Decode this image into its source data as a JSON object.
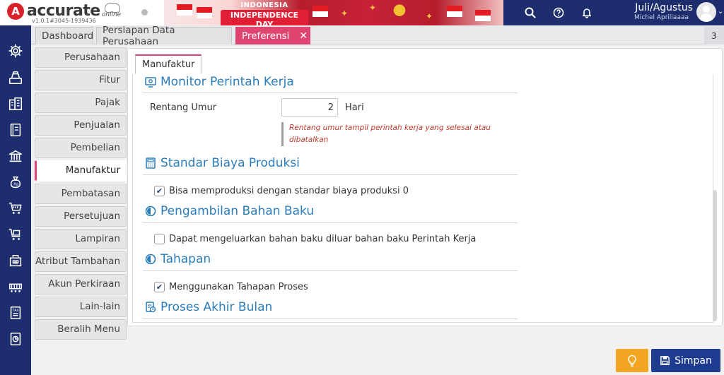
{
  "app": {
    "brand": "accurate",
    "brand_suffix": "online",
    "version": "v1.0.1#3045-1939436",
    "banner_line1": "INDONESIA",
    "banner_line2": "INDEPENDENCE DAY"
  },
  "user": {
    "period": "Juli/Agustus",
    "name": "Michel Apriliaaaa"
  },
  "header_icons": [
    "search-icon",
    "help-icon",
    "bell-icon"
  ],
  "rail_icons": [
    "gear-icon",
    "cash-register-icon",
    "building-icon",
    "ledger-book-icon",
    "bank-icon",
    "money-bag-icon",
    "shopping-cart-icon",
    "cart-box-icon",
    "warehouse-icon",
    "production-line-icon",
    "tax-icon",
    "report-chart-icon"
  ],
  "tabs": [
    {
      "label": "Dashboard",
      "active": false
    },
    {
      "label": "Persiapan Data Perusahaan",
      "active": false
    },
    {
      "label": "Preferensi",
      "active": true
    }
  ],
  "tab_count": "3",
  "sections_menu": [
    {
      "label": "Perusahaan",
      "active": false
    },
    {
      "label": "Fitur",
      "active": false
    },
    {
      "label": "Pajak",
      "active": false
    },
    {
      "label": "Penjualan",
      "active": false
    },
    {
      "label": "Pembelian",
      "active": false
    },
    {
      "label": "Manufaktur",
      "active": true
    },
    {
      "label": "Pembatasan",
      "active": false
    },
    {
      "label": "Persetujuan",
      "active": false
    },
    {
      "label": "Lampiran",
      "active": false
    },
    {
      "label": "Atribut Tambahan",
      "active": false
    },
    {
      "label": "Akun Perkiraan",
      "active": false
    },
    {
      "label": "Lain-lain",
      "active": false
    },
    {
      "label": "Beralih Menu",
      "active": false
    }
  ],
  "panel": {
    "subtab": "Manufaktur",
    "monitor": {
      "title": "Monitor Perintah Kerja",
      "age_label": "Rentang Umur",
      "age_value": "2",
      "age_unit": "Hari",
      "hint": "Rentang umur tampil perintah kerja yang selesai atau dibatalkan"
    },
    "standard_cost": {
      "title": "Standar Biaya Produksi",
      "option": "Bisa memproduksi dengan standar biaya produksi 0",
      "checked": true
    },
    "material_taking": {
      "title": "Pengambilan Bahan Baku",
      "option": "Dapat mengeluarkan bahan baku diluar bahan baku Perintah Kerja",
      "checked": false
    },
    "stages": {
      "title": "Tahapan",
      "option": "Menggunakan Tahapan Proses",
      "checked": true
    },
    "month_end": {
      "title": "Proses Akhir Bulan"
    }
  },
  "buttons": {
    "save": "Simpan"
  },
  "colors": {
    "navy": "#1d2d6e",
    "accent_pink": "#e04471",
    "section_blue": "#2a7db8",
    "save_blue": "#1d3b8f",
    "tips_orange": "#f4a623"
  }
}
